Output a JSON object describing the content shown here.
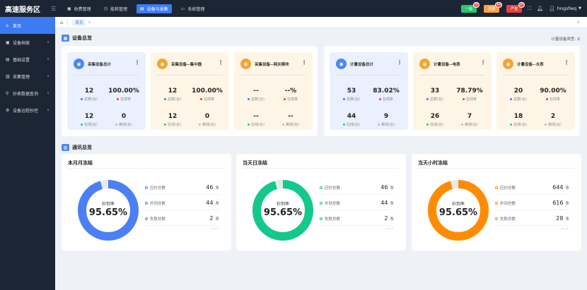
{
  "app": {
    "title": "高速服务区"
  },
  "topnav": {
    "items": [
      {
        "label": "收费管理",
        "icon": "monitor-icon"
      },
      {
        "label": "能耗管理",
        "icon": "clock-icon"
      },
      {
        "label": "设备与采集",
        "icon": "device-icon"
      },
      {
        "label": "系统管理",
        "icon": "screen-icon"
      }
    ],
    "active": 2
  },
  "alarms": [
    {
      "label": "一般",
      "count": "0",
      "color": "#28c76f"
    },
    {
      "label": "重要",
      "count": "12",
      "color": "#ff9f43"
    },
    {
      "label": "严重",
      "count": "0",
      "color": "#ea3f3f"
    }
  ],
  "user": {
    "name": "hngsfwq"
  },
  "sidebar": {
    "items": [
      {
        "label": "首页",
        "icon": "home-icon",
        "active": true,
        "chevron": false
      },
      {
        "label": "设备档案",
        "icon": "file-icon",
        "chevron": true
      },
      {
        "label": "基础设置",
        "icon": "settings-icon",
        "chevron": true
      },
      {
        "label": "采集管理",
        "icon": "collect-icon",
        "chevron": true
      },
      {
        "label": "抄表数据查询",
        "icon": "search-icon",
        "chevron": true
      },
      {
        "label": "设备远程抄控",
        "icon": "remote-icon",
        "chevron": true
      }
    ]
  },
  "breadcrumb": {
    "tab": "首页",
    "close": "×",
    "more": "∨"
  },
  "overview": {
    "title": "设备总览",
    "count_label": "计量设备类型:",
    "count_value": "2"
  },
  "collect_cards": [
    {
      "title": "采集设备总计",
      "icon_color": "#4b86f6",
      "theme": "blue",
      "stats": [
        {
          "value": "12",
          "label": "总数(台)",
          "dot": "#3d7bf5"
        },
        {
          "value": "100.00%",
          "label": "在线率",
          "dot": "#ea3f3f"
        },
        {
          "value": "12",
          "label": "在线(台)",
          "dot": "#28c76f"
        },
        {
          "value": "0",
          "label": "离线(台)",
          "dot": "#bbbbbb"
        }
      ]
    },
    {
      "title": "采集设备--集中器",
      "icon_color": "#f7a22f",
      "theme": "yellow",
      "stats": [
        {
          "value": "12",
          "label": "总数(台)",
          "dot": "#3d7bf5"
        },
        {
          "value": "100.00%",
          "label": "在线率",
          "dot": "#ea3f3f"
        },
        {
          "value": "12",
          "label": "在线(台)",
          "dot": "#28c76f"
        },
        {
          "value": "0",
          "label": "离线(台)",
          "dot": "#bbbbbb"
        }
      ]
    },
    {
      "title": "采集设备--网关模块",
      "icon_color": "#f7a22f",
      "theme": "yellow",
      "stats": [
        {
          "value": "--",
          "label": "总数(台)",
          "dot": "#3d7bf5"
        },
        {
          "value": "--%",
          "label": "在线率",
          "dot": "#ea3f3f"
        },
        {
          "value": "--",
          "label": "在线(台)",
          "dot": "#28c76f"
        },
        {
          "value": "--",
          "label": "离线(台)",
          "dot": "#bbbbbb"
        }
      ]
    }
  ],
  "meter_cards": [
    {
      "title": "计量设备总计",
      "icon_color": "#4b86f6",
      "theme": "blue",
      "stats": [
        {
          "value": "53",
          "label": "总数(台)",
          "dot": "#3d7bf5"
        },
        {
          "value": "83.02%",
          "label": "在线率",
          "dot": "#ea3f3f"
        },
        {
          "value": "44",
          "label": "在线(台)",
          "dot": "#28c76f"
        },
        {
          "value": "9",
          "label": "离线(台)",
          "dot": "#bbbbbb"
        }
      ]
    },
    {
      "title": "计量设备--电表",
      "icon_color": "#f7a22f",
      "theme": "yellow",
      "stats": [
        {
          "value": "33",
          "label": "总数(台)",
          "dot": "#3d7bf5"
        },
        {
          "value": "78.79%",
          "label": "在线率",
          "dot": "#ea3f3f"
        },
        {
          "value": "26",
          "label": "在线(台)",
          "dot": "#28c76f"
        },
        {
          "value": "7",
          "label": "离线(台)",
          "dot": "#bbbbbb"
        }
      ]
    },
    {
      "title": "计量设备--水表",
      "icon_color": "#f7a22f",
      "theme": "yellow",
      "stats": [
        {
          "value": "20",
          "label": "总数(台)",
          "dot": "#3d7bf5"
        },
        {
          "value": "90.00%",
          "label": "在线率",
          "dot": "#ea3f3f"
        },
        {
          "value": "18",
          "label": "在线(台)",
          "dot": "#28c76f"
        },
        {
          "value": "2",
          "label": "离线(台)",
          "dot": "#bbbbbb"
        }
      ]
    }
  ],
  "comm": {
    "title": "通讯总览"
  },
  "comm_cards": [
    {
      "title": "本月月冻结",
      "rate_label": "抄到率",
      "rate": "95.65%",
      "rate_value": 0.9565,
      "color": "#4b7ff5",
      "rows": [
        {
          "label": "应抄总数",
          "value": "46",
          "unit": "条"
        },
        {
          "label": "抄到总数",
          "value": "44",
          "unit": "条"
        },
        {
          "label": "失败总数",
          "value": "2",
          "unit": "条"
        }
      ],
      "more": "···"
    },
    {
      "title": "当天日冻结",
      "rate_label": "抄到率",
      "rate": "95.65%",
      "rate_value": 0.9565,
      "color": "#13c98a",
      "rows": [
        {
          "label": "应抄总数",
          "value": "46",
          "unit": "条"
        },
        {
          "label": "抄到总数",
          "value": "44",
          "unit": "条"
        },
        {
          "label": "失败总数",
          "value": "2",
          "unit": "条"
        }
      ],
      "more": "···"
    },
    {
      "title": "当天小时冻结",
      "rate_label": "抄到率",
      "rate": "95.65%",
      "rate_value": 0.9565,
      "color": "#ff8c00",
      "rows": [
        {
          "label": "应抄总数",
          "value": "644",
          "unit": "条"
        },
        {
          "label": "抄到总数",
          "value": "616",
          "unit": "条"
        },
        {
          "label": "失败总数",
          "value": "28",
          "unit": "条"
        }
      ],
      "more": "···"
    }
  ]
}
